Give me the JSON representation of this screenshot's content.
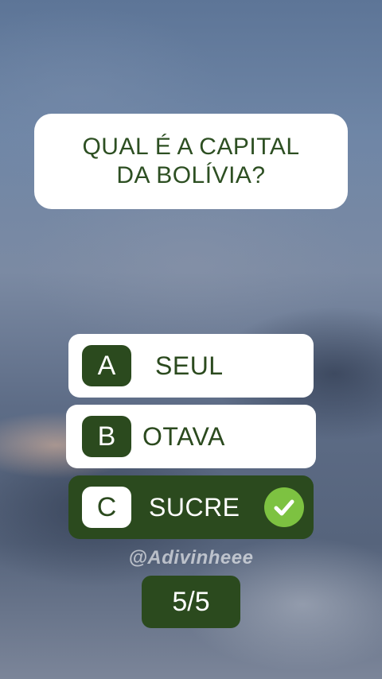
{
  "question": {
    "line1": "QUAL É A CAPITAL",
    "line2": "DA BOLÍVIA?"
  },
  "options": [
    {
      "letter": "A",
      "text": "SEUL",
      "state": "neutral"
    },
    {
      "letter": "B",
      "text": "OTAVA",
      "state": "neutral"
    },
    {
      "letter": "C",
      "text": "SUCRE",
      "state": "correct",
      "icon": "check-circle-icon"
    }
  ],
  "watermark": "@Adivinheee",
  "progress": {
    "label": "5/5",
    "current": 5,
    "total": 5
  },
  "colors": {
    "accent_green": "#2b4a1e",
    "text_green": "#2d4f22",
    "check_green": "#7dc241",
    "card_white": "#ffffff"
  }
}
